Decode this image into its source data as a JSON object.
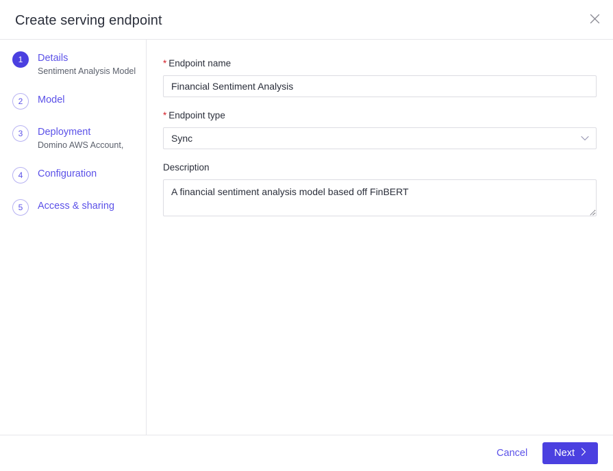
{
  "header": {
    "title": "Create serving endpoint",
    "close_icon": "close-icon"
  },
  "steps": [
    {
      "number": "1",
      "label": "Details",
      "sub": "Sentiment Analysis Model",
      "state": "active"
    },
    {
      "number": "2",
      "label": "Model",
      "sub": "",
      "state": "inactive"
    },
    {
      "number": "3",
      "label": "Deployment",
      "sub": "Domino AWS Account,",
      "state": "inactive"
    },
    {
      "number": "4",
      "label": "Configuration",
      "sub": "",
      "state": "inactive"
    },
    {
      "number": "5",
      "label": "Access & sharing",
      "sub": "",
      "state": "inactive"
    }
  ],
  "form": {
    "endpoint_name": {
      "label": "Endpoint name",
      "required_marker": "*",
      "value": "Financial Sentiment Analysis",
      "placeholder": ""
    },
    "endpoint_type": {
      "label": "Endpoint type",
      "required_marker": "*",
      "value": "Sync",
      "chevron_icon": "chevron-down-icon"
    },
    "description": {
      "label": "Description",
      "value": "A financial sentiment analysis model based off FinBERT",
      "placeholder": ""
    }
  },
  "footer": {
    "cancel_label": "Cancel",
    "next_label": "Next",
    "next_chevron_icon": "chevron-right-icon"
  },
  "colors": {
    "accent": "#4b40e0",
    "link": "#5b51e8",
    "required": "#d32029",
    "border": "#e6e6ea",
    "field_border": "#dcdce2",
    "text": "#2a2e3a",
    "muted": "#5a5f6b"
  }
}
